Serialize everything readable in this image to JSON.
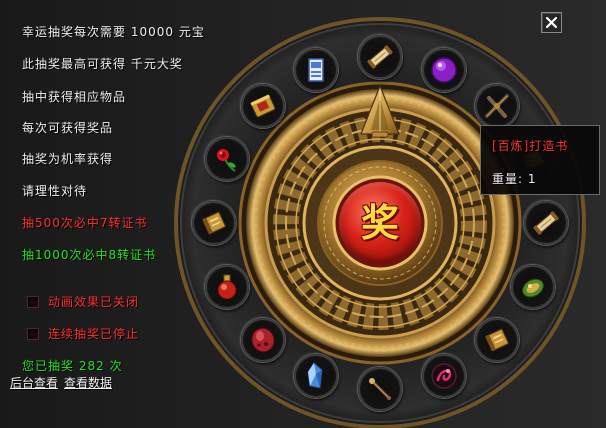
{
  "info_panel": {
    "cost_line": {
      "prefix": "幸运抽奖每次需要",
      "amount": "10000",
      "currency": "元宝"
    },
    "top_prize_line": {
      "prefix": "此抽奖最高可获得",
      "prize": "千元大奖"
    },
    "notes": [
      "抽中获得相应物品",
      "每次可获得奖品",
      "抽奖为机率获得",
      "请理性对待"
    ],
    "guarantee_500": "抽500次必中7转证书",
    "guarantee_1000": "抽1000次必中8转证书",
    "options": [
      {
        "label": "动画效果已关闭",
        "checked": false
      },
      {
        "label": "连续抽奖已停止",
        "checked": false
      }
    ],
    "draw_count": {
      "prefix": "您已抽奖",
      "count": 282,
      "suffix": "次"
    },
    "links": {
      "backend": "后台查看",
      "view_data": "查看数据"
    }
  },
  "wheel": {
    "spin_button_label": "奖",
    "pointer_icon": "pointer-arrow-icon",
    "slots": [
      {
        "icon": "scroll-icon"
      },
      {
        "icon": "purple-orb-icon"
      },
      {
        "icon": "weapon-icon"
      },
      {
        "icon": "book-icon"
      },
      {
        "icon": "scroll-icon"
      },
      {
        "icon": "helmet-icon"
      },
      {
        "icon": "book-icon"
      },
      {
        "icon": "emblem-icon"
      },
      {
        "icon": "wand-icon"
      },
      {
        "icon": "crystal-icon"
      },
      {
        "icon": "red-gem-icon"
      },
      {
        "icon": "potion-icon"
      },
      {
        "icon": "book-icon"
      },
      {
        "icon": "rose-icon"
      },
      {
        "icon": "armor-icon"
      },
      {
        "icon": "card-icon"
      }
    ]
  },
  "tooltip": {
    "item_name": "[百炼]打造书",
    "weight_label": "重量:",
    "weight_value": "1"
  },
  "close_button": {
    "icon": "close-icon"
  },
  "colors": {
    "gold": "#c99a46",
    "text_white": "#f0f0f0",
    "warning_red": "#ff2e2e",
    "notice_green": "#28e028",
    "spin_button_red": "#d8241a",
    "spin_label_yellow": "#ffdc3c",
    "tooltip_title_red": "#ff3232"
  }
}
